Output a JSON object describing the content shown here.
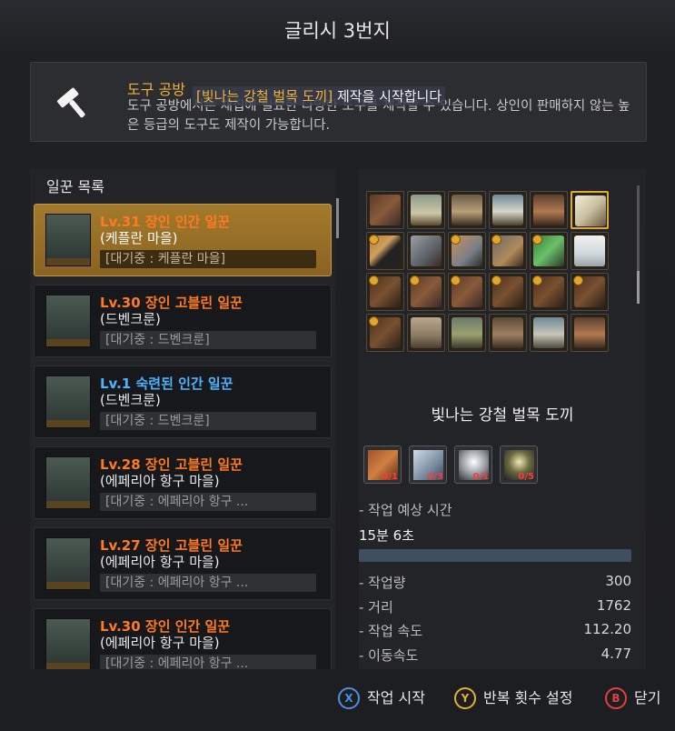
{
  "window": {
    "title": "글리시 3번지"
  },
  "info": {
    "title": "도구 공방",
    "overlay_prefix": "[빛나는 강철 벌목 도끼]",
    "overlay_suffix": " 제작을 시작합니다",
    "desc": "도구 공방에서는 채집에 필요한 다양한 도구를 제작할 수 있습니다. 상인이 판매하지 않는 높은 등급의 도구도 제작이 가능합니다."
  },
  "workers": {
    "heading": "일꾼 목록",
    "items": [
      {
        "name": "Lv.31 장인 인간 일꾼",
        "town": "(케플란 마을)",
        "status": "[대기중 : 케플란 마을]",
        "color": "orange",
        "selected": true
      },
      {
        "name": "Lv.30 장인 고블린 일꾼",
        "town": "(드벤크룬)",
        "status": "[대기중 : 드벤크룬]",
        "color": "orange",
        "selected": false
      },
      {
        "name": "Lv.1 숙련된 인간 일꾼",
        "town": "(드벤크룬)",
        "status": "[대기중 : 드벤크룬]",
        "color": "blue",
        "selected": false
      },
      {
        "name": "Lv.28 장인 고블린 일꾼",
        "town": "(에페리아 항구 마을)",
        "status": "[대기중 : 에페리아 항구 ...",
        "color": "orange",
        "selected": false
      },
      {
        "name": "Lv.27 장인 고블린 일꾼",
        "town": "(에페리아 항구 마을)",
        "status": "[대기중 : 에페리아 항구 ...",
        "color": "orange",
        "selected": false
      },
      {
        "name": "Lv.30 장인 인간 일꾼",
        "town": "(에페리아 항구 마을)",
        "status": "[대기중 : 에페리아 항구 ...",
        "color": "orange",
        "selected": false
      }
    ]
  },
  "recipe_grid": {
    "icons": [
      "crossbow-icon",
      "tent-icon",
      "workshop-icon",
      "house-icon",
      "furnace-icon",
      "axe-icon",
      "hoe-icon",
      "cleaver-icon",
      "knife-icon",
      "pickaxe-icon",
      "syringe-icon",
      "bottle-icon",
      "bow-icon",
      "crossbow-icon",
      "crossbow-icon",
      "bow-icon",
      "bow-icon",
      "bow-icon",
      "bow-icon",
      "pillar-icon",
      "stall-icon",
      "anvil-icon",
      "wagon-icon",
      "furnace-icon"
    ],
    "selected_index": 5
  },
  "item": {
    "name": "빛나는 강철 벌목 도끼",
    "materials": [
      {
        "icon": "log-icon",
        "count": "0/1"
      },
      {
        "icon": "steel-ingot-icon",
        "count": "0/3"
      },
      {
        "icon": "crystal-shard-icon",
        "count": "0/1"
      },
      {
        "icon": "black-stone-icon",
        "count": "0/5"
      }
    ]
  },
  "work": {
    "time_label": "- 작업 예상 시간",
    "time_value": "15분 6초",
    "progress": 0,
    "stats": [
      {
        "label": "- 작업량",
        "value": "300"
      },
      {
        "label": "- 거리",
        "value": "1762"
      },
      {
        "label": "- 작업 속도",
        "value": "112.20"
      },
      {
        "label": "- 이동속도",
        "value": "4.77"
      }
    ]
  },
  "footer": {
    "start": {
      "key": "X",
      "label": "작업 시작",
      "color": "#4a8fe0"
    },
    "repeat": {
      "key": "Y",
      "label": "반복 횟수 설정",
      "color": "#e0b030"
    },
    "close": {
      "key": "B",
      "label": "닫기",
      "color": "#e04040"
    }
  }
}
